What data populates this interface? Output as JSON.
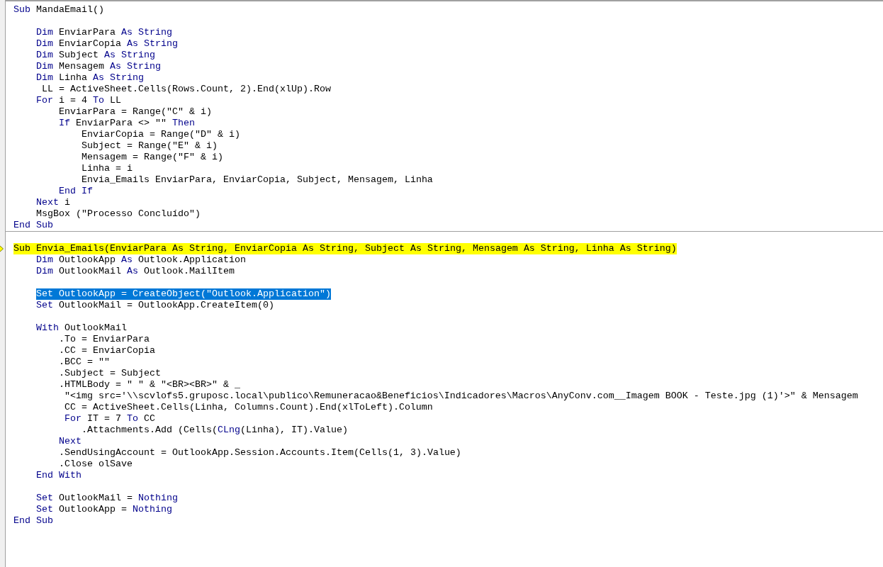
{
  "procedures": [
    {
      "lines": [
        {
          "kind": "code",
          "segments": [
            {
              "text": "Sub",
              "kind": "keyword"
            },
            {
              "text": " MandaEmail()",
              "kind": "code"
            }
          ]
        },
        {
          "kind": "blank"
        },
        {
          "kind": "code",
          "segments": [
            {
              "text": "    Dim",
              "kind": "keyword"
            },
            {
              "text": " EnviarPara ",
              "kind": "code"
            },
            {
              "text": "As String",
              "kind": "keyword"
            }
          ]
        },
        {
          "kind": "code",
          "segments": [
            {
              "text": "    Dim",
              "kind": "keyword"
            },
            {
              "text": " EnviarCopia ",
              "kind": "code"
            },
            {
              "text": "As String",
              "kind": "keyword"
            }
          ]
        },
        {
          "kind": "code",
          "segments": [
            {
              "text": "    Dim",
              "kind": "keyword"
            },
            {
              "text": " Subject ",
              "kind": "code"
            },
            {
              "text": "As String",
              "kind": "keyword"
            }
          ]
        },
        {
          "kind": "code",
          "segments": [
            {
              "text": "    Dim",
              "kind": "keyword"
            },
            {
              "text": " Mensagem ",
              "kind": "code"
            },
            {
              "text": "As String",
              "kind": "keyword"
            }
          ]
        },
        {
          "kind": "code",
          "segments": [
            {
              "text": "    Dim",
              "kind": "keyword"
            },
            {
              "text": " Linha ",
              "kind": "code"
            },
            {
              "text": "As String",
              "kind": "keyword"
            }
          ]
        },
        {
          "kind": "code",
          "segments": [
            {
              "text": "     LL = ActiveSheet.Cells(Rows.Count, 2).End(xlUp).Row",
              "kind": "code"
            }
          ]
        },
        {
          "kind": "code",
          "segments": [
            {
              "text": "    For",
              "kind": "keyword"
            },
            {
              "text": " i = 4 ",
              "kind": "code"
            },
            {
              "text": "To",
              "kind": "keyword"
            },
            {
              "text": " LL",
              "kind": "code"
            }
          ]
        },
        {
          "kind": "code",
          "segments": [
            {
              "text": "        EnviarPara = Range(\"C\" & i)",
              "kind": "code"
            }
          ]
        },
        {
          "kind": "code",
          "segments": [
            {
              "text": "        If",
              "kind": "keyword"
            },
            {
              "text": " EnviarPara <> \"\" ",
              "kind": "code"
            },
            {
              "text": "Then",
              "kind": "keyword"
            }
          ]
        },
        {
          "kind": "code",
          "segments": [
            {
              "text": "            EnviarCopia = Range(\"D\" & i)",
              "kind": "code"
            }
          ]
        },
        {
          "kind": "code",
          "segments": [
            {
              "text": "            Subject = Range(\"E\" & i)",
              "kind": "code"
            }
          ]
        },
        {
          "kind": "code",
          "segments": [
            {
              "text": "            Mensagem = Range(\"F\" & i)",
              "kind": "code"
            }
          ]
        },
        {
          "kind": "code",
          "segments": [
            {
              "text": "            Linha = i",
              "kind": "code"
            }
          ]
        },
        {
          "kind": "code",
          "segments": [
            {
              "text": "            Envia_Emails EnviarPara, EnviarCopia, Subject, Mensagem, Linha",
              "kind": "code"
            }
          ]
        },
        {
          "kind": "code",
          "segments": [
            {
              "text": "        End If",
              "kind": "keyword"
            }
          ]
        },
        {
          "kind": "code",
          "segments": [
            {
              "text": "    Next",
              "kind": "keyword"
            },
            {
              "text": " i",
              "kind": "code"
            }
          ]
        },
        {
          "kind": "code",
          "segments": [
            {
              "text": "    MsgBox (\"Processo Concluído\")",
              "kind": "code"
            }
          ]
        },
        {
          "kind": "code",
          "segments": [
            {
              "text": "End Sub",
              "kind": "keyword"
            }
          ]
        }
      ]
    },
    {
      "lines": [
        {
          "kind": "blank"
        },
        {
          "kind": "code",
          "execution": true,
          "segments": [
            {
              "text": "Sub",
              "kind": "keyword"
            },
            {
              "text": " Envia_Emails(EnviarPara ",
              "kind": "code"
            },
            {
              "text": "As String",
              "kind": "keyword"
            },
            {
              "text": ", EnviarCopia ",
              "kind": "code"
            },
            {
              "text": "As String",
              "kind": "keyword"
            },
            {
              "text": ", Subject ",
              "kind": "code"
            },
            {
              "text": "As String",
              "kind": "keyword"
            },
            {
              "text": ", Mensagem ",
              "kind": "code"
            },
            {
              "text": "As String",
              "kind": "keyword"
            },
            {
              "text": ", Linha ",
              "kind": "code"
            },
            {
              "text": "As String",
              "kind": "keyword"
            },
            {
              "text": ")",
              "kind": "code"
            }
          ]
        },
        {
          "kind": "code",
          "segments": [
            {
              "text": "    Dim",
              "kind": "keyword"
            },
            {
              "text": " OutlookApp ",
              "kind": "code"
            },
            {
              "text": "As",
              "kind": "keyword"
            },
            {
              "text": " Outlook.Application",
              "kind": "code"
            }
          ]
        },
        {
          "kind": "code",
          "segments": [
            {
              "text": "    Dim",
              "kind": "keyword"
            },
            {
              "text": " OutlookMail ",
              "kind": "code"
            },
            {
              "text": "As",
              "kind": "keyword"
            },
            {
              "text": " Outlook.MailItem",
              "kind": "code"
            }
          ]
        },
        {
          "kind": "blank"
        },
        {
          "kind": "code",
          "selected": true,
          "segments": [
            {
              "text": "    Set",
              "kind": "keyword"
            },
            {
              "text": " OutlookApp = CreateObject(\"Outlook.Application\")",
              "kind": "code"
            }
          ]
        },
        {
          "kind": "code",
          "segments": [
            {
              "text": "    Set",
              "kind": "keyword"
            },
            {
              "text": " OutlookMail = OutlookApp.CreateItem(0)",
              "kind": "code"
            }
          ]
        },
        {
          "kind": "blank"
        },
        {
          "kind": "code",
          "segments": [
            {
              "text": "    With",
              "kind": "keyword"
            },
            {
              "text": " OutlookMail",
              "kind": "code"
            }
          ]
        },
        {
          "kind": "code",
          "segments": [
            {
              "text": "        .To = EnviarPara",
              "kind": "code"
            }
          ]
        },
        {
          "kind": "code",
          "segments": [
            {
              "text": "        .CC = EnviarCopia",
              "kind": "code"
            }
          ]
        },
        {
          "kind": "code",
          "segments": [
            {
              "text": "        .BCC = \"\"",
              "kind": "code"
            }
          ]
        },
        {
          "kind": "code",
          "segments": [
            {
              "text": "        .Subject = Subject",
              "kind": "code"
            }
          ]
        },
        {
          "kind": "code",
          "segments": [
            {
              "text": "        .HTMLBody = \" \" & \"<BR><BR>\" & _",
              "kind": "code"
            }
          ]
        },
        {
          "kind": "code",
          "segments": [
            {
              "text": "         \"<img src='\\\\scvlofs5.gruposc.local\\publico\\Remuneracao&Beneficios\\Indicadores\\Macros\\AnyConv.com__Imagem BOOK - Teste.jpg (1)'>\" & Mensagem",
              "kind": "code"
            }
          ]
        },
        {
          "kind": "code",
          "segments": [
            {
              "text": "         CC = ActiveSheet.Cells(Linha, Columns.Count).End(xlToLeft).Column",
              "kind": "code"
            }
          ]
        },
        {
          "kind": "code",
          "segments": [
            {
              "text": "         For",
              "kind": "keyword"
            },
            {
              "text": " IT = 7 ",
              "kind": "code"
            },
            {
              "text": "To",
              "kind": "keyword"
            },
            {
              "text": " CC",
              "kind": "code"
            }
          ]
        },
        {
          "kind": "code",
          "segments": [
            {
              "text": "            .Attachments.Add (Cells(",
              "kind": "code"
            },
            {
              "text": "CLng",
              "kind": "keyword"
            },
            {
              "text": "(Linha), IT).Value)",
              "kind": "code"
            }
          ]
        },
        {
          "kind": "code",
          "segments": [
            {
              "text": "        Next",
              "kind": "keyword"
            }
          ]
        },
        {
          "kind": "code",
          "segments": [
            {
              "text": "        .SendUsingAccount = OutlookApp.Session.Accounts.Item(Cells(1, 3).Value)",
              "kind": "code"
            }
          ]
        },
        {
          "kind": "code",
          "segments": [
            {
              "text": "        .Close olSave",
              "kind": "code"
            }
          ]
        },
        {
          "kind": "code",
          "segments": [
            {
              "text": "    End With",
              "kind": "keyword"
            }
          ]
        },
        {
          "kind": "blank"
        },
        {
          "kind": "code",
          "segments": [
            {
              "text": "    Set",
              "kind": "keyword"
            },
            {
              "text": " OutlookMail = ",
              "kind": "code"
            },
            {
              "text": "Nothing",
              "kind": "keyword"
            }
          ]
        },
        {
          "kind": "code",
          "segments": [
            {
              "text": "    Set",
              "kind": "keyword"
            },
            {
              "text": " OutlookApp = ",
              "kind": "code"
            },
            {
              "text": "Nothing",
              "kind": "keyword"
            }
          ]
        },
        {
          "kind": "code",
          "segments": [
            {
              "text": "End Sub",
              "kind": "keyword"
            }
          ]
        }
      ]
    }
  ]
}
